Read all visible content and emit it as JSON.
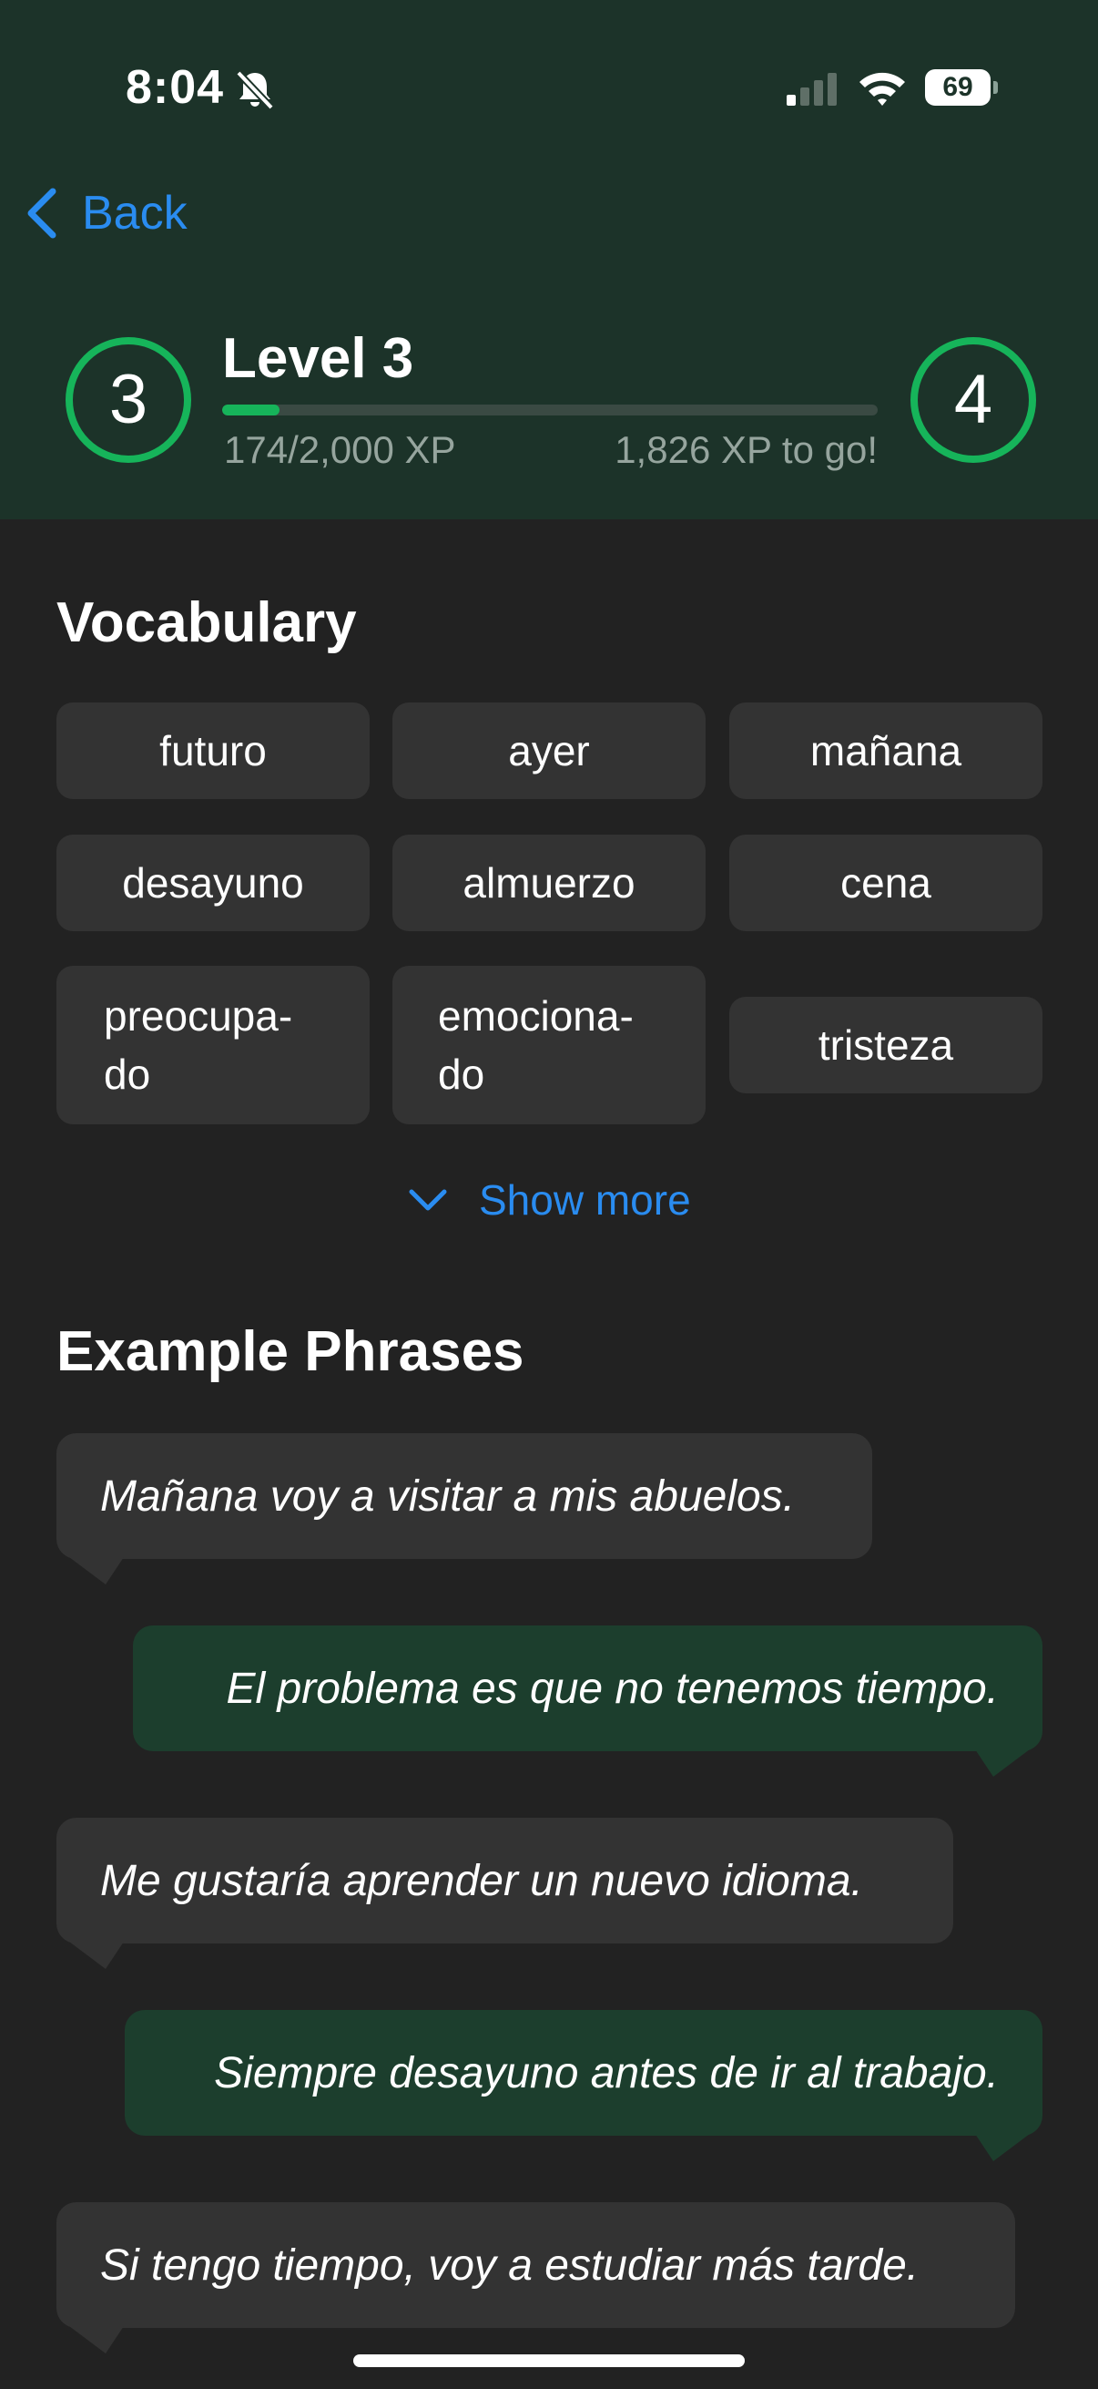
{
  "status_bar": {
    "time": "8:04",
    "battery": "69"
  },
  "nav": {
    "back_label": "Back"
  },
  "level": {
    "current": "3",
    "next": "4",
    "title": "Level 3",
    "xp_text": "174/2,000 XP",
    "remaining_text": "1,826 XP to go!",
    "progress_fraction": 0.087
  },
  "vocabulary": {
    "title": "Vocabulary",
    "words": [
      "futuro",
      "ayer",
      "mañana",
      "desayuno",
      "almuerzo",
      "cena",
      "preocupa-\ndo",
      "emociona-\ndo",
      "tristeza"
    ],
    "show_more_label": "Show more"
  },
  "phrases": {
    "title": "Example Phrases",
    "items": [
      "Mañana voy a visitar a mis abuelos.",
      "El problema es que no tenemos tiempo.",
      "Me gustaría aprender un nuevo idioma.",
      "Siempre desayuno antes de ir al trabajo.",
      "Si tengo tiempo, voy a estudiar más tarde."
    ]
  },
  "colors": {
    "header_bg": "#1c3329",
    "background": "#222222",
    "accent_green": "#16b45a",
    "link_blue": "#2a8cf0",
    "chip_bg": "#333333",
    "bubble_right_bg": "#1c3e2d"
  }
}
